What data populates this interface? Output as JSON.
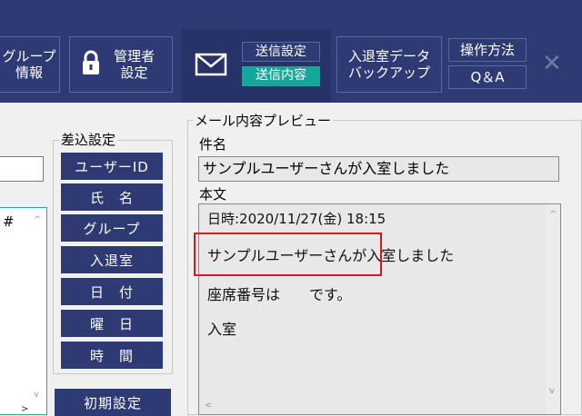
{
  "toolbar": {
    "group_info": {
      "line1": "グループ",
      "line2": "情報"
    },
    "admin_settings": {
      "line1": "管理者",
      "line2": "設定"
    },
    "send_settings": "送信設定",
    "send_content": "送信内容",
    "backup": {
      "line1": "入退室データ",
      "line2": "バックアップ"
    },
    "howto": "操作方法",
    "qa": "Q＆A",
    "close_glyph": "✕"
  },
  "left_panel": {
    "hash": "#"
  },
  "insert_settings": {
    "title": "差込設定",
    "buttons": [
      "ユーザーID",
      "氏　名",
      "グループ",
      "入退室",
      "日　付",
      "曜　日",
      "時　間"
    ],
    "reset_button": "初期設定"
  },
  "preview": {
    "title": "メール内容プレビュー",
    "subject_label": "件名",
    "subject_value": "サンプルユーザーさんが入室しました",
    "body_label": "本文",
    "body_lines": [
      "日時:2020/11/27(金) 18:15",
      "サンプルユーザーさんが入室しました",
      "座席番号は　　です。",
      "入室"
    ],
    "highlight_color": "#e0141e"
  },
  "colors": {
    "navy": "#2d3a73",
    "teal_selected": "#14a79a"
  }
}
